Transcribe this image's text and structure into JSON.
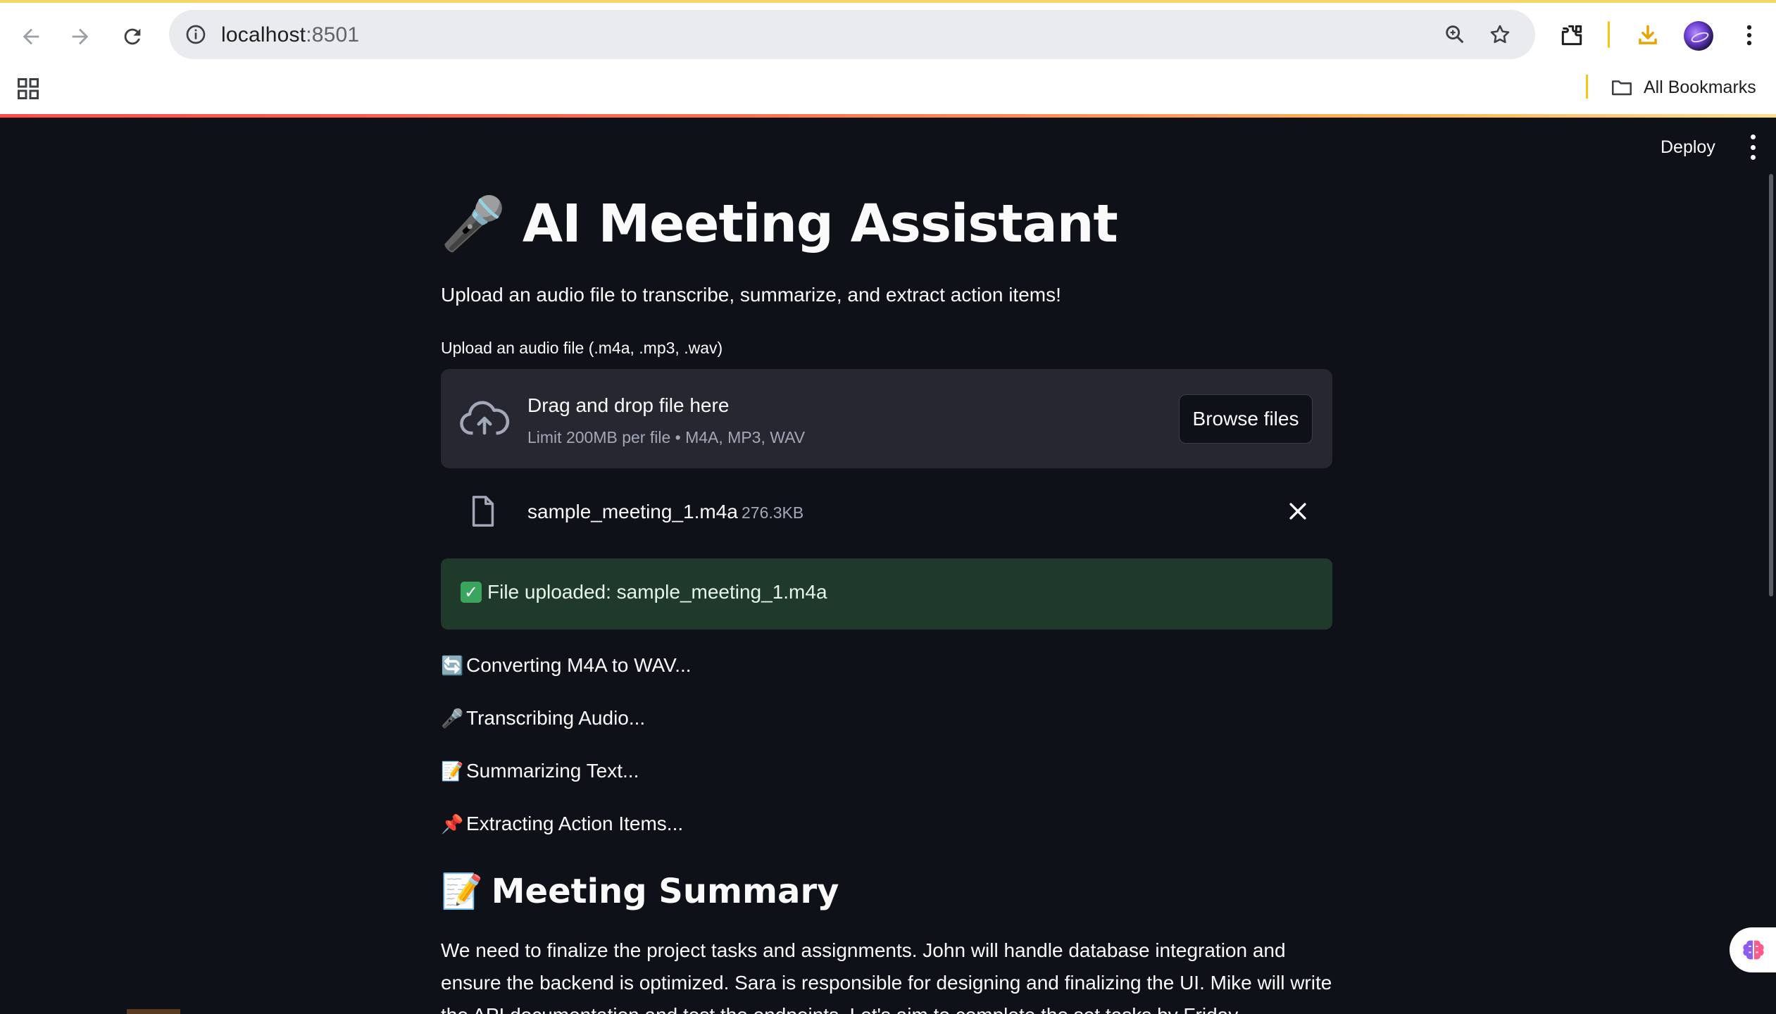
{
  "browser": {
    "url_host": "localhost",
    "url_port": ":8501",
    "bookmarks_label": "All Bookmarks"
  },
  "app_header": {
    "deploy_label": "Deploy"
  },
  "page": {
    "title": "🎤 AI Meeting Assistant",
    "subtitle": "Upload an audio file to transcribe, summarize, and extract action items!",
    "upload_label": "Upload an audio file (.m4a, .mp3, .wav)"
  },
  "uploader": {
    "drop_title": "Drag and drop file here",
    "drop_limit": "Limit 200MB per file • M4A, MP3, WAV",
    "browse_label": "Browse files",
    "file_name": "sample_meeting_1.m4a",
    "file_size": "276.3KB"
  },
  "status": {
    "success_text": "File uploaded: sample_meeting_1.m4a",
    "steps": [
      {
        "emoji": "🔄",
        "text": "Converting M4A to WAV..."
      },
      {
        "emoji": "🎤",
        "text": "Transcribing Audio..."
      },
      {
        "emoji": "📝",
        "text": "Summarizing Text..."
      },
      {
        "emoji": "📌",
        "text": "Extracting Action Items..."
      }
    ]
  },
  "summary": {
    "heading_emoji": "📝",
    "heading": "Meeting Summary",
    "text": "We need to finalize the project tasks and assignments. John will handle database integration and ensure the backend is optimized. Sara is responsible for designing and finalizing the UI. Mike will write the API documentation and test the endpoints. Let's aim to complete the set tasks by Friday."
  },
  "colors": {
    "app_bg": "#0e1117",
    "dropzone_bg": "#262730",
    "success_bg": "#1f3a2a",
    "accent": "#ff4b4b"
  }
}
